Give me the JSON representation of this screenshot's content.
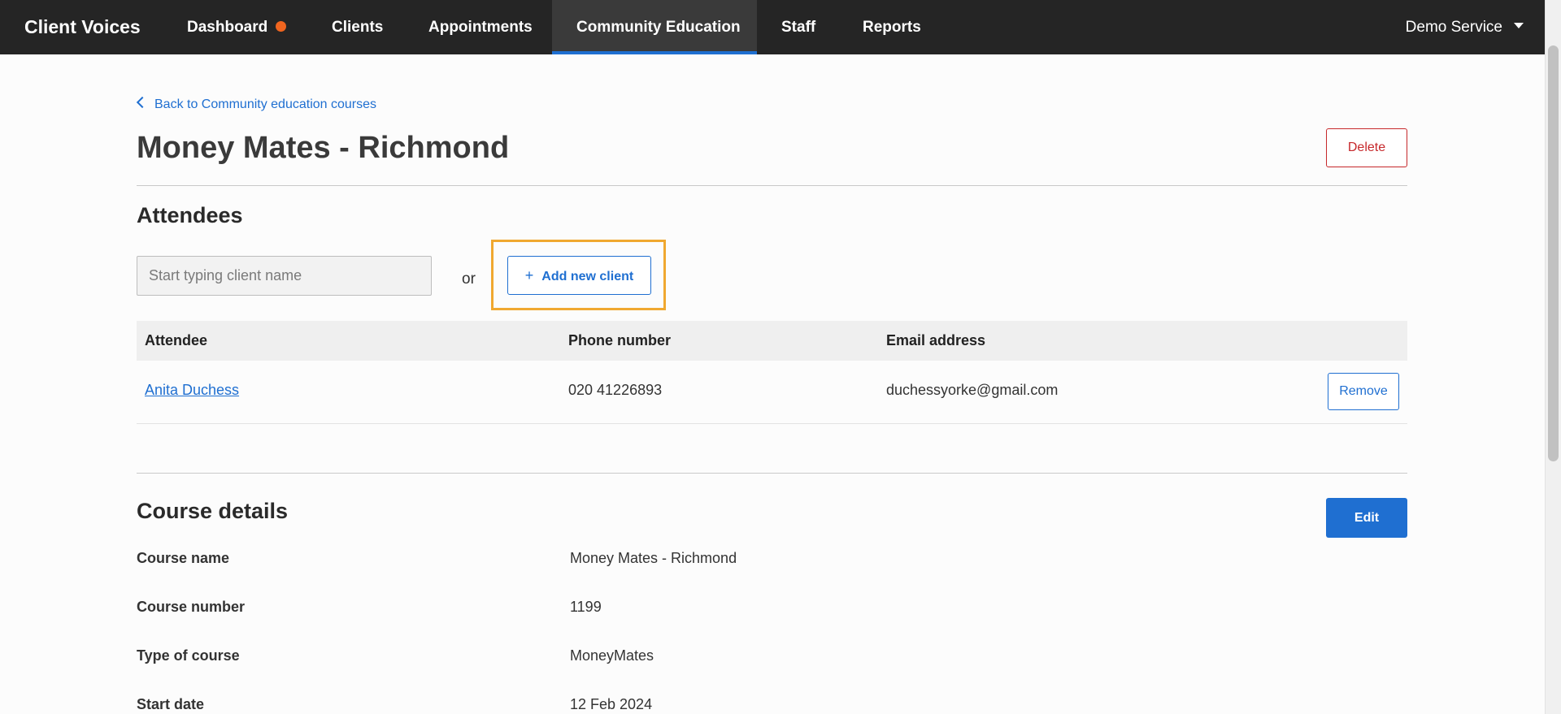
{
  "nav": {
    "brand": "Client Voices",
    "items": [
      {
        "label": "Dashboard"
      },
      {
        "label": "Clients"
      },
      {
        "label": "Appointments"
      },
      {
        "label": "Community Education"
      },
      {
        "label": "Staff"
      },
      {
        "label": "Reports"
      }
    ],
    "service": "Demo Service"
  },
  "page": {
    "back_link": "Back to Community education courses",
    "title": "Money Mates - Richmond",
    "delete_label": "Delete"
  },
  "attendees": {
    "heading": "Attendees",
    "search_placeholder": "Start typing client name",
    "or_text": "or",
    "add_icon": "+",
    "add_label": "Add new client",
    "columns": [
      "Attendee",
      "Phone number",
      "Email address"
    ],
    "rows": [
      {
        "name": "Anita Duchess",
        "phone": "020 41226893",
        "email": "duchessyorke@gmail.com",
        "action": "Remove"
      }
    ]
  },
  "course": {
    "heading": "Course details",
    "edit_label": "Edit",
    "fields": [
      {
        "label": "Course name",
        "value": "Money Mates - Richmond"
      },
      {
        "label": "Course number",
        "value": "1199"
      },
      {
        "label": "Type of course",
        "value": "MoneyMates"
      },
      {
        "label": "Start date",
        "value": "12 Feb 2024"
      }
    ]
  },
  "colors": {
    "accent": "#1f6fd1",
    "danger": "#c6282b",
    "notification": "#f0651f",
    "highlight": "#f0a830",
    "nav_bg": "#252525"
  }
}
